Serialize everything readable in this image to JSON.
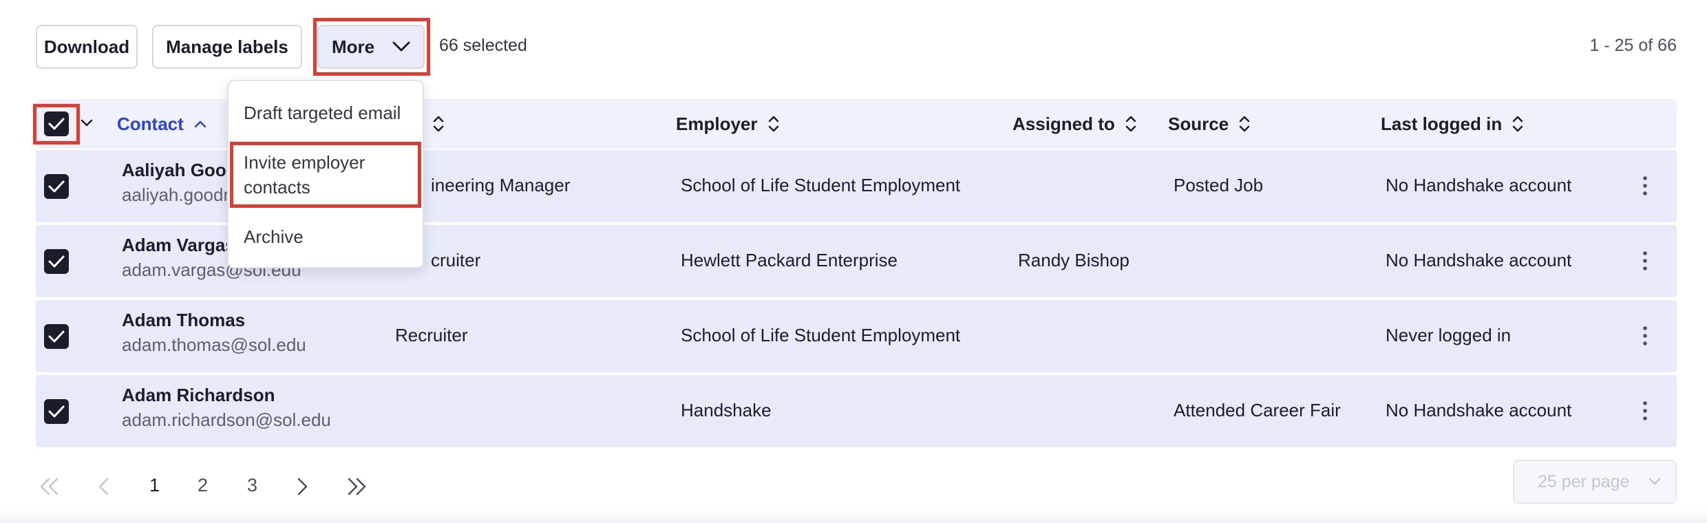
{
  "toolbar": {
    "download_label": "Download",
    "manage_labels_label": "Manage labels",
    "more_label": "More",
    "selected_count": "66 selected",
    "range_text": "1 - 25 of 66"
  },
  "more_menu": {
    "items": [
      {
        "label": "Draft targeted email"
      },
      {
        "label": "Invite employer contacts",
        "line1": "Invite employer",
        "line2": "contacts"
      },
      {
        "label": "Archive"
      }
    ]
  },
  "table": {
    "headers": {
      "contact": "Contact",
      "employer": "Employer",
      "assigned_to": "Assigned to",
      "source": "Source",
      "last_logged_in": "Last logged in"
    },
    "rows": [
      {
        "name": "Aaliyah Good",
        "email": "aaliyah.goodr",
        "title": "ineering Manager",
        "employer": "School of Life Student Employment",
        "assigned_to": "",
        "source": "Posted Job",
        "last_logged_in": "No Handshake account"
      },
      {
        "name": "Adam Vargas",
        "email": "adam.vargas@sol.edu",
        "title": "cruiter",
        "employer": "Hewlett Packard Enterprise",
        "assigned_to": "Randy Bishop",
        "source": "",
        "last_logged_in": "No Handshake account"
      },
      {
        "name": "Adam Thomas",
        "email": "adam.thomas@sol.edu",
        "title": "Recruiter",
        "employer": "School of Life Student Employment",
        "assigned_to": "",
        "source": "",
        "last_logged_in": "Never logged in"
      },
      {
        "name": "Adam Richardson",
        "email": "adam.richardson@sol.edu",
        "title": "",
        "employer": "Handshake",
        "assigned_to": "",
        "source": "Attended Career Fair",
        "last_logged_in": "No Handshake account"
      }
    ]
  },
  "pagination": {
    "pages": [
      "1",
      "2",
      "3"
    ],
    "current_page": "1",
    "per_page": "25 per page"
  },
  "colors": {
    "accent": "#2a44d6",
    "highlight_red": "#e23b2f",
    "row_selected": "#e6eaf9",
    "header_bg": "#eff1fb"
  }
}
